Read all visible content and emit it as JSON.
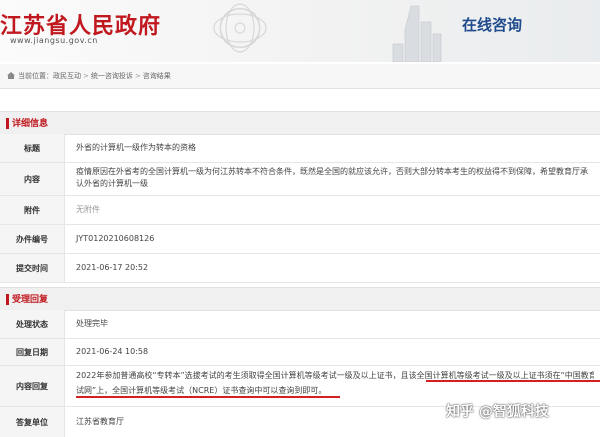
{
  "header": {
    "logo_text": "江苏省人民政府",
    "url": "www.jiangsu.gov.cn",
    "site_title": "在线咨询"
  },
  "breadcrumb": {
    "label": "当前位置：",
    "items": [
      "政民互动",
      "统一咨询投诉",
      "咨询结果"
    ]
  },
  "detail": {
    "section_title": "详细信息",
    "rows": [
      {
        "label": "标题",
        "value": "外省的计算机一级作为转本的资格"
      },
      {
        "label": "内容",
        "value": "疫情原因在外省考的全国计算机一级为何江苏转本不符合条件，既然是全国的就应该允许，否则大部分转本考生的权益得不到保障，希望教育厅承认外省的计算机一级"
      },
      {
        "label": "附件",
        "value": "无附件"
      },
      {
        "label": "办件编号",
        "value": "JYT0120210608126"
      },
      {
        "label": "提交时间",
        "value": "2021-06-17 20:52"
      }
    ]
  },
  "reply": {
    "section_title": "受理回复",
    "rows": [
      {
        "label": "处理状态",
        "value": "处理完毕"
      },
      {
        "label": "回复日期",
        "value": "2021-06-24 10:58"
      },
      {
        "label": "内容回复",
        "value_line1": "2022年参加普通高校“专转本”选拔考试的考生须取得全国计算机等级考试一级及以上证书，且该全国计算机等级考试一级及以上证书须在“中国教育考",
        "value_line2": "试网”上，全国计算机等级考试（NCRE）证书查询中可以查询到即可。"
      },
      {
        "label": "答复单位",
        "value": "江苏省教育厅"
      }
    ]
  },
  "watermark": "知乎 @智狐科技",
  "colors": {
    "accent": "#c0181e",
    "site_title": "#1f4a8c",
    "highlight": "#d42020"
  }
}
